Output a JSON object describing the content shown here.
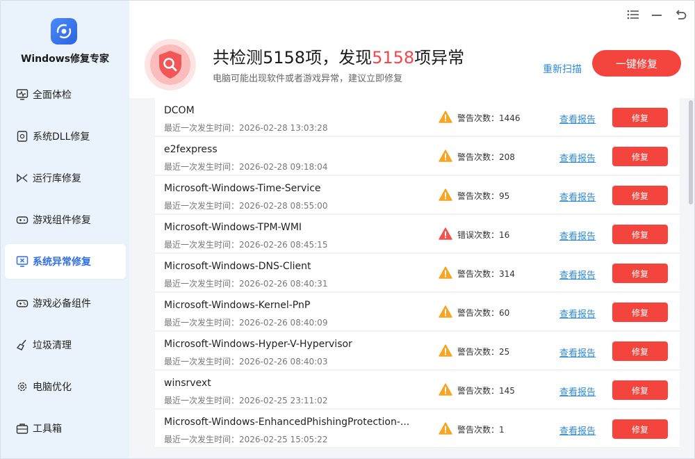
{
  "app": {
    "title": "Windows修复专家"
  },
  "sidebar": {
    "items": [
      {
        "label": "全面体检",
        "icon": "monitor-pulse-icon"
      },
      {
        "label": "系统DLL修复",
        "icon": "dll-file-icon"
      },
      {
        "label": "运行库修复",
        "icon": "runtime-icon"
      },
      {
        "label": "游戏组件修复",
        "icon": "gamepad-icon"
      },
      {
        "label": "系统异常修复",
        "icon": "monitor-x-icon",
        "active": true
      },
      {
        "label": "游戏必备组件",
        "icon": "gamepad-plus-icon"
      },
      {
        "label": "垃圾清理",
        "icon": "broom-icon"
      },
      {
        "label": "电脑优化",
        "icon": "gear-icon"
      },
      {
        "label": "工具箱",
        "icon": "toolbox-icon"
      }
    ]
  },
  "header": {
    "prefix": "共检测",
    "checked": "5158",
    "mid": "项，发现",
    "found": "5158",
    "suffix": "项异常",
    "subtitle": "电脑可能出现软件或者游戏异常，建议立即修复",
    "rescan_label": "重新扫描",
    "fix_all_label": "一键修复"
  },
  "colors": {
    "accent_red": "#f3443d",
    "link_blue": "#2b8ad8",
    "warn_orange": "#f5a623",
    "error_red": "#ef5350"
  },
  "list": {
    "report_label": "查看报告",
    "fix_label": "修复",
    "items": [
      {
        "name": "DCOM",
        "time": "最近一次发生时间：2026-02-28 13:03:28",
        "type": "warning",
        "count": "警告次数：1446"
      },
      {
        "name": "e2fexpress",
        "time": "最近一次发生时间：2026-02-28 09:18:04",
        "type": "warning",
        "count": "警告次数：208"
      },
      {
        "name": "Microsoft-Windows-Time-Service",
        "time": "最近一次发生时间：2026-02-28 08:55:00",
        "type": "warning",
        "count": "警告次数：95"
      },
      {
        "name": "Microsoft-Windows-TPM-WMI",
        "time": "最近一次发生时间：2026-02-26 08:45:15",
        "type": "error",
        "count": "错误次数：16"
      },
      {
        "name": "Microsoft-Windows-DNS-Client",
        "time": "最近一次发生时间：2026-02-26 08:40:31",
        "type": "warning",
        "count": "警告次数：314"
      },
      {
        "name": "Microsoft-Windows-Kernel-PnP",
        "time": "最近一次发生时间：2026-02-26 08:40:09",
        "type": "warning",
        "count": "警告次数：60"
      },
      {
        "name": "Microsoft-Windows-Hyper-V-Hypervisor",
        "time": "最近一次发生时间：2026-02-26 08:40:03",
        "type": "warning",
        "count": "警告次数：25"
      },
      {
        "name": "winsrvext",
        "time": "最近一次发生时间：2026-02-25 23:11:02",
        "type": "warning",
        "count": "警告次数：145"
      },
      {
        "name": "Microsoft-Windows-EnhancedPhishingProtection-...",
        "time": "最近一次发生时间：2026-02-25 15:05:22",
        "type": "warning",
        "count": "警告次数：1"
      }
    ]
  }
}
